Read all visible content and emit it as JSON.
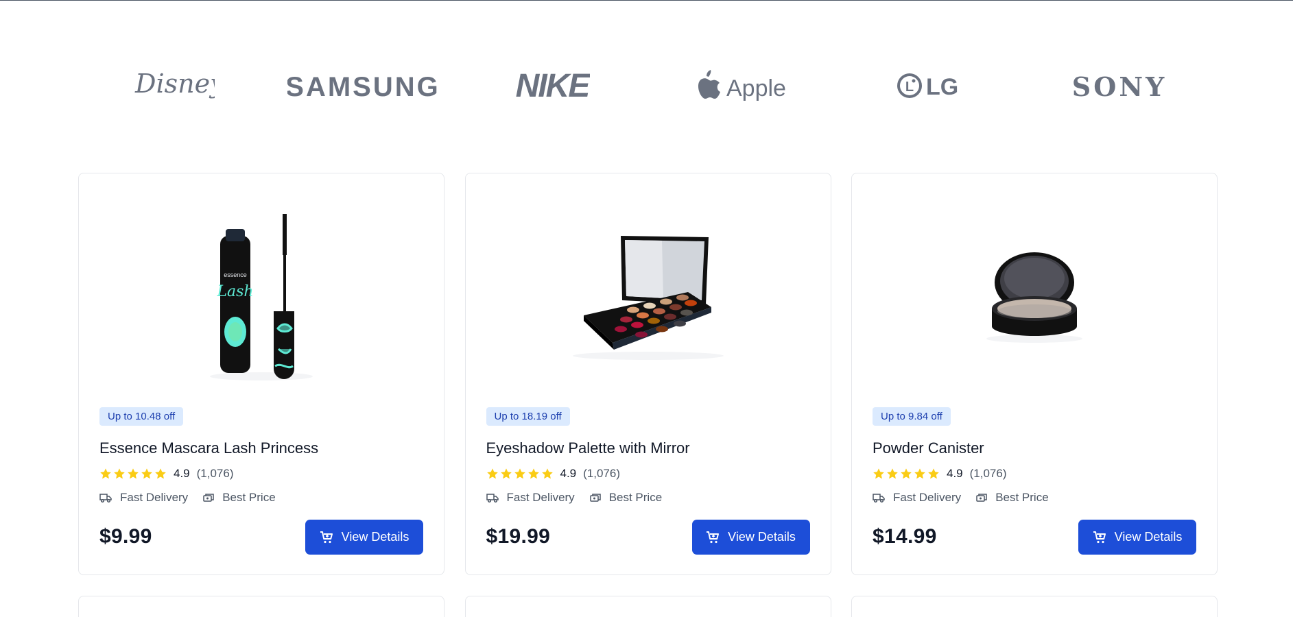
{
  "brands": [
    {
      "name": "Disney",
      "icon": "disney-logo"
    },
    {
      "name": "SAMSUNG",
      "icon": "samsung-logo"
    },
    {
      "name": "NIKE",
      "icon": "nike-logo"
    },
    {
      "name": "Apple",
      "icon": "apple-logo"
    },
    {
      "name": "LG",
      "icon": "lg-logo"
    },
    {
      "name": "SONY",
      "icon": "sony-logo"
    }
  ],
  "colors": {
    "accent": "#1d4ed8",
    "badge_bg": "#dbeafe",
    "badge_text": "#1e40af",
    "star": "#facc15",
    "brand_gray": "#6b7280"
  },
  "products": [
    {
      "badge": "Up to 10.48 off",
      "title": "Essence Mascara Lash Princess",
      "rating": "4.9",
      "stars": 5,
      "reviews": "(1,076)",
      "feature_1": "Fast Delivery",
      "feature_2": "Best Price",
      "price": "$9.99",
      "button": "View Details",
      "image": "mascara-image",
      "brand_print": "essence",
      "brand_print_2": "Lash"
    },
    {
      "badge": "Up to 18.19 off",
      "title": "Eyeshadow Palette with Mirror",
      "rating": "4.9",
      "stars": 5,
      "reviews": "(1,076)",
      "feature_1": "Fast Delivery",
      "feature_2": "Best Price",
      "price": "$19.99",
      "button": "View Details",
      "image": "eyeshadow-palette-image"
    },
    {
      "badge": "Up to 9.84 off",
      "title": "Powder Canister",
      "rating": "4.9",
      "stars": 5,
      "reviews": "(1,076)",
      "feature_1": "Fast Delivery",
      "feature_2": "Best Price",
      "price": "$14.99",
      "button": "View Details",
      "image": "powder-canister-image"
    }
  ]
}
